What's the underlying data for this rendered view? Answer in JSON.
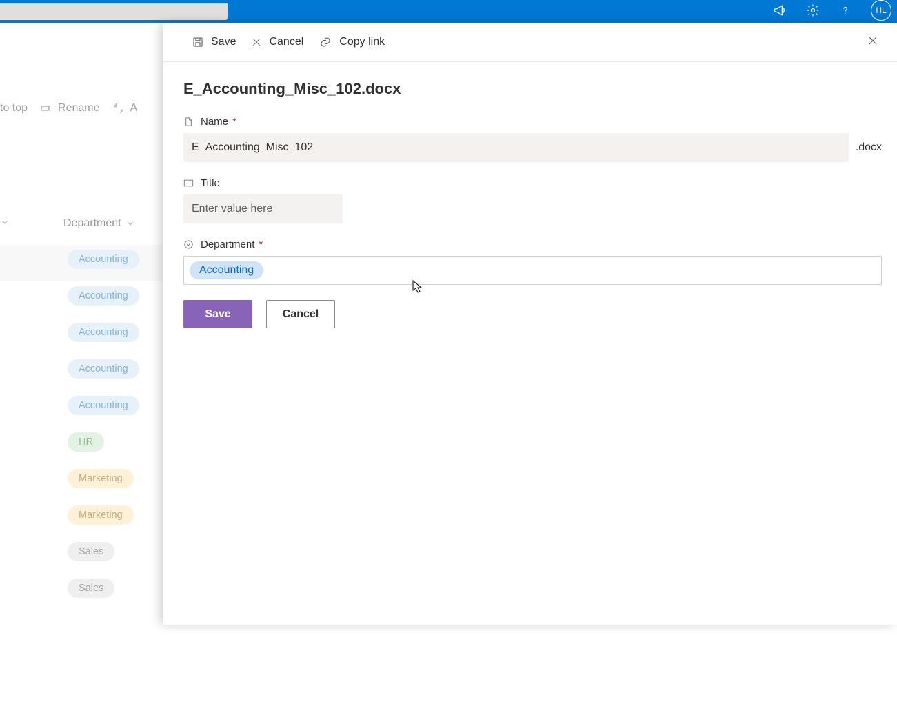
{
  "header": {
    "avatar_initials": "HL"
  },
  "bg": {
    "toolbar": {
      "to_top_fragment": "to top",
      "rename": "Rename",
      "automate_fragment": "A"
    },
    "column_header": "Department",
    "rows": [
      {
        "label": "Accounting",
        "cls": "pill-accounting"
      },
      {
        "label": "Accounting",
        "cls": "pill-accounting"
      },
      {
        "label": "Accounting",
        "cls": "pill-accounting"
      },
      {
        "label": "Accounting",
        "cls": "pill-accounting"
      },
      {
        "label": "Accounting",
        "cls": "pill-accounting"
      },
      {
        "label": "HR",
        "cls": "pill-hr"
      },
      {
        "label": "Marketing",
        "cls": "pill-marketing"
      },
      {
        "label": "Marketing",
        "cls": "pill-marketing"
      },
      {
        "label": "Sales",
        "cls": "pill-sales"
      },
      {
        "label": "Sales",
        "cls": "pill-sales"
      }
    ]
  },
  "panel": {
    "cmd": {
      "save": "Save",
      "cancel": "Cancel",
      "copy_link": "Copy link"
    },
    "title": "E_Accounting_Misc_102.docx",
    "fields": {
      "name": {
        "label": "Name",
        "value": "E_Accounting_Misc_102",
        "extension": ".docx"
      },
      "title": {
        "label": "Title",
        "placeholder": "Enter value here",
        "value": ""
      },
      "department": {
        "label": "Department",
        "selected": "Accounting"
      }
    },
    "buttons": {
      "save": "Save",
      "cancel": "Cancel"
    }
  }
}
